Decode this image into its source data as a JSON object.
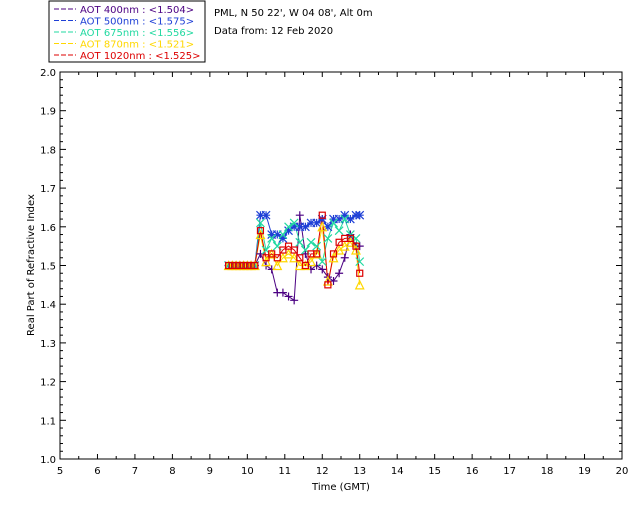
{
  "header": {
    "site_line": "PML, N 50 22', W 04 08', Alt 0m",
    "date_line": "Data from: 12 Feb 2020"
  },
  "legend": [
    {
      "label": "AOT  400nm : <1.504>",
      "color": "#4b0082",
      "marker": "plus"
    },
    {
      "label": "AOT  500nm : <1.575>",
      "color": "#1e3fd6",
      "marker": "asterisk"
    },
    {
      "label": "AOT  675nm : <1.556>",
      "color": "#20d9a0",
      "marker": "x"
    },
    {
      "label": "AOT  870nm : <1.521>",
      "color": "#ffd700",
      "marker": "triangle"
    },
    {
      "label": "AOT 1020nm : <1.525>",
      "color": "#dd0000",
      "marker": "square"
    }
  ],
  "chart_data": {
    "type": "line",
    "xlabel": "Time (GMT)",
    "ylabel": "Real Part of Refractive Index",
    "xlim": [
      5,
      20
    ],
    "ylim": [
      1.0,
      2.0
    ],
    "xticks": [
      "5",
      "6",
      "7",
      "8",
      "9",
      "10",
      "11",
      "12",
      "13",
      "14",
      "15",
      "16",
      "17",
      "18",
      "19",
      "20"
    ],
    "yticks": [
      "1.0",
      "1.1",
      "1.2",
      "1.3",
      "1.4",
      "1.5",
      "1.6",
      "1.7",
      "1.8",
      "1.9",
      "2.0"
    ],
    "x": [
      9.5,
      9.6,
      9.7,
      9.8,
      9.9,
      10.0,
      10.1,
      10.2,
      10.35,
      10.5,
      10.65,
      10.8,
      10.95,
      11.1,
      11.25,
      11.4,
      11.55,
      11.7,
      11.85,
      12.0,
      12.15,
      12.3,
      12.45,
      12.6,
      12.75,
      12.9,
      13.0
    ],
    "series": [
      {
        "name": "AOT  400nm : <1.504>",
        "values": [
          1.5,
          1.5,
          1.5,
          1.5,
          1.5,
          1.5,
          1.5,
          1.5,
          1.53,
          1.5,
          1.49,
          1.43,
          1.43,
          1.42,
          1.41,
          1.63,
          1.53,
          1.49,
          1.5,
          1.49,
          1.47,
          1.46,
          1.48,
          1.52,
          1.58,
          1.55,
          1.55
        ]
      },
      {
        "name": "AOT  500nm : <1.575>",
        "values": [
          1.5,
          1.5,
          1.5,
          1.5,
          1.5,
          1.5,
          1.5,
          1.5,
          1.63,
          1.63,
          1.58,
          1.58,
          1.57,
          1.59,
          1.6,
          1.6,
          1.6,
          1.61,
          1.61,
          1.62,
          1.6,
          1.62,
          1.62,
          1.63,
          1.62,
          1.63,
          1.63
        ]
      },
      {
        "name": "AOT  675nm : <1.556>",
        "values": [
          1.5,
          1.5,
          1.5,
          1.5,
          1.5,
          1.5,
          1.5,
          1.5,
          1.61,
          1.54,
          1.57,
          1.55,
          1.58,
          1.6,
          1.61,
          1.56,
          1.54,
          1.56,
          1.55,
          1.51,
          1.57,
          1.61,
          1.59,
          1.62,
          1.58,
          1.57,
          1.51
        ]
      },
      {
        "name": "AOT  870nm : <1.521>",
        "values": [
          1.5,
          1.5,
          1.5,
          1.5,
          1.5,
          1.5,
          1.5,
          1.5,
          1.58,
          1.51,
          1.53,
          1.5,
          1.52,
          1.53,
          1.52,
          1.5,
          1.5,
          1.51,
          1.53,
          1.6,
          1.46,
          1.52,
          1.54,
          1.55,
          1.56,
          1.54,
          1.45
        ]
      },
      {
        "name": "AOT 1020nm : <1.525>",
        "values": [
          1.5,
          1.5,
          1.5,
          1.5,
          1.5,
          1.5,
          1.5,
          1.5,
          1.59,
          1.52,
          1.53,
          1.52,
          1.54,
          1.55,
          1.54,
          1.52,
          1.5,
          1.53,
          1.53,
          1.63,
          1.45,
          1.53,
          1.56,
          1.57,
          1.57,
          1.55,
          1.48
        ]
      }
    ]
  }
}
